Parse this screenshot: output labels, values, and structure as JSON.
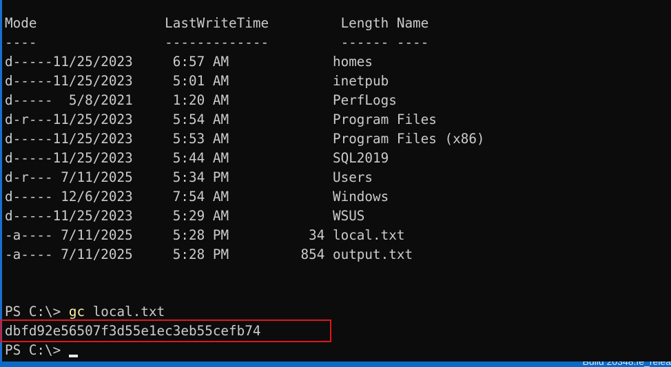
{
  "terminal": {
    "header": {
      "mode": "Mode",
      "last_write_time": "LastWriteTime",
      "length": "Length",
      "name": "Name"
    },
    "separator": {
      "mode": "----",
      "last_write_time": "-------------",
      "length": "------",
      "name": "----"
    },
    "rows": [
      {
        "mode": "d-----",
        "date": "11/25/2023",
        "time": "6:57 AM",
        "length": "",
        "name": "homes"
      },
      {
        "mode": "d-----",
        "date": "11/25/2023",
        "time": "5:01 AM",
        "length": "",
        "name": "inetpub"
      },
      {
        "mode": "d-----",
        "date": "5/8/2021",
        "time": "1:20 AM",
        "length": "",
        "name": "PerfLogs"
      },
      {
        "mode": "d-r---",
        "date": "11/25/2023",
        "time": "5:54 AM",
        "length": "",
        "name": "Program Files"
      },
      {
        "mode": "d-----",
        "date": "11/25/2023",
        "time": "5:53 AM",
        "length": "",
        "name": "Program Files (x86)"
      },
      {
        "mode": "d-----",
        "date": "11/25/2023",
        "time": "5:44 AM",
        "length": "",
        "name": "SQL2019"
      },
      {
        "mode": "d-r---",
        "date": "7/11/2025",
        "time": "5:34 PM",
        "length": "",
        "name": "Users"
      },
      {
        "mode": "d-----",
        "date": "12/6/2023",
        "time": "7:54 AM",
        "length": "",
        "name": "Windows"
      },
      {
        "mode": "d-----",
        "date": "11/25/2023",
        "time": "5:29 AM",
        "length": "",
        "name": "WSUS"
      },
      {
        "mode": "-a----",
        "date": "7/11/2025",
        "time": "5:28 PM",
        "length": "34",
        "name": "local.txt"
      },
      {
        "mode": "-a----",
        "date": "7/11/2025",
        "time": "5:28 PM",
        "length": "854",
        "name": "output.txt"
      }
    ],
    "prompt1": {
      "prompt": "PS C:\\> ",
      "command": "gc",
      "args": " local.txt"
    },
    "output": "dbfd92e56507f3d55e1ec3eb55cefb74",
    "prompt2": {
      "prompt": "PS C:\\> "
    }
  },
  "taskbar": {
    "text": "Build 20348.fe_relea"
  },
  "colors": {
    "background": "#0c0c0c",
    "text": "#cccccc",
    "command": "#f9f1a5",
    "highlight_border": "#e0161e",
    "taskbar": "#0b69c7",
    "window_edge": "#1b6fd1"
  }
}
